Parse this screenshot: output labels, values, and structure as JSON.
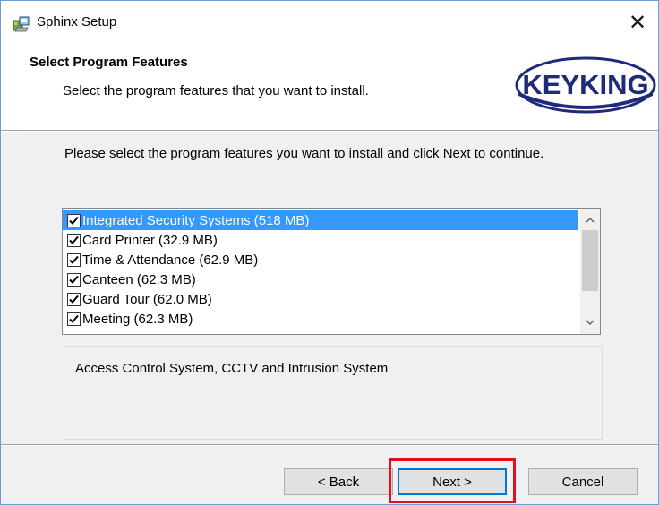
{
  "window": {
    "title": "Sphinx Setup",
    "icon": "installer-package-icon",
    "close_glyph": "✕"
  },
  "header": {
    "title": "Select Program Features",
    "subtitle": "Select the program features that you want to install.",
    "logo_text": "KEYKING"
  },
  "main": {
    "instruction": "Please select the program features you want to install and click Next to continue.",
    "features": [
      {
        "label": "Integrated Security Systems (518 MB)",
        "checked": true,
        "selected": true
      },
      {
        "label": "Card Printer (32.9 MB)",
        "checked": true,
        "selected": false
      },
      {
        "label": "Time & Attendance (62.9 MB)",
        "checked": true,
        "selected": false
      },
      {
        "label": "Canteen (62.3 MB)",
        "checked": true,
        "selected": false
      },
      {
        "label": "Guard Tour (62.0 MB)",
        "checked": true,
        "selected": false
      },
      {
        "label": "Meeting (62.3 MB)",
        "checked": true,
        "selected": false
      }
    ],
    "description": "Access Control System, CCTV and Intrusion System"
  },
  "footer": {
    "back_label": "< Back",
    "next_label": "Next >",
    "cancel_label": "Cancel"
  },
  "colors": {
    "selection": "#3399ff",
    "highlight": "#e0101e",
    "logo_blue": "#1f2a7a"
  }
}
